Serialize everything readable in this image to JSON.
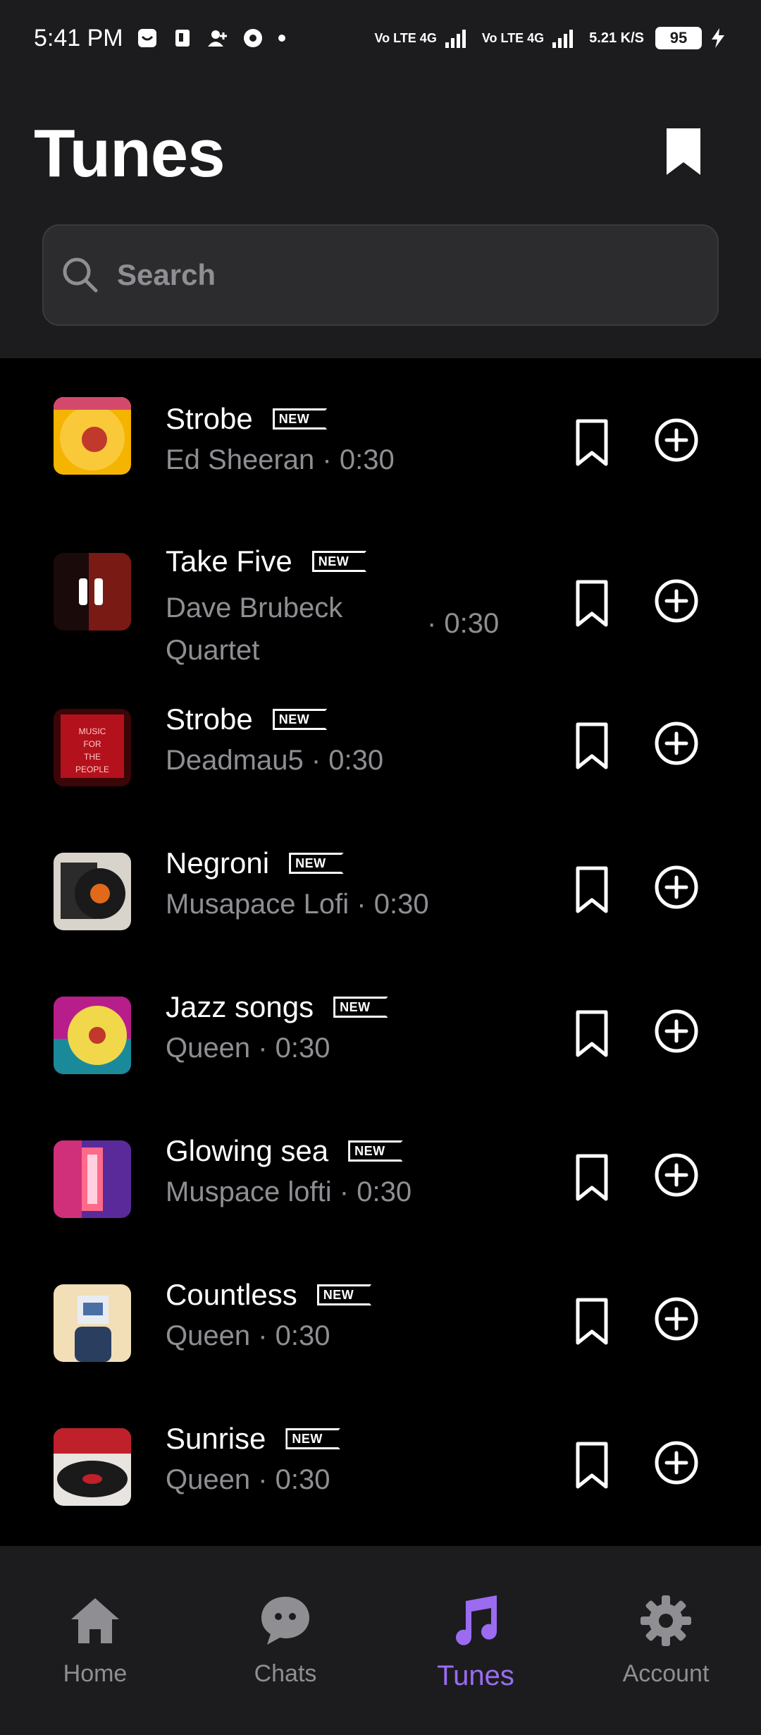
{
  "status_bar": {
    "time": "5:41 PM",
    "net_speed": "5.21 K/S",
    "battery": "95",
    "sim1": "Vo LTE 4G",
    "sim2": "Vo LTE 4G"
  },
  "header": {
    "title": "Tunes",
    "bookmark_icon": "bookmark-filled-icon"
  },
  "search": {
    "placeholder": "Search",
    "value": ""
  },
  "tracks": [
    {
      "title": "Strobe",
      "badge": "NEW",
      "artist": "Ed Sheeran",
      "duration": "· 0:30",
      "art": "yellow-vinyl"
    },
    {
      "title": "Take Five",
      "badge": "NEW",
      "artist": "Dave Brubeck Quartet",
      "duration": "· 0:30",
      "art": "red-pause"
    },
    {
      "title": "Strobe",
      "badge": "NEW",
      "artist": "Deadmau5",
      "duration": "· 0:30",
      "art": "neon-sign"
    },
    {
      "title": "Negroni",
      "badge": "NEW",
      "artist": "Musapace Lofi",
      "duration": "· 0:30",
      "art": "record-sleeve"
    },
    {
      "title": "Jazz songs",
      "badge": "NEW",
      "artist": "Queen",
      "duration": "· 0:30",
      "art": "pink-vinyl"
    },
    {
      "title": "Glowing sea",
      "badge": "NEW",
      "artist": "Muspace lofti",
      "duration": "· 0:30",
      "art": "glow-corridor"
    },
    {
      "title": "Countless",
      "badge": "NEW",
      "artist": "Queen",
      "duration": "· 0:30",
      "art": "paper-head"
    },
    {
      "title": "Sunrise",
      "badge": "NEW",
      "artist": "Queen",
      "duration": "· 0:30",
      "art": "turntable"
    }
  ],
  "nav": {
    "items": [
      {
        "label": "Home",
        "icon": "home-icon"
      },
      {
        "label": "Chats",
        "icon": "chat-bubble-icon"
      },
      {
        "label": "Tunes",
        "icon": "music-note-icon"
      },
      {
        "label": "Account",
        "icon": "gear-icon"
      }
    ],
    "active": "Tunes"
  },
  "colors": {
    "accent": "#9b6cf2",
    "background": "#000000",
    "surface": "#1c1c1e",
    "muted_text": "#8e8e93"
  }
}
